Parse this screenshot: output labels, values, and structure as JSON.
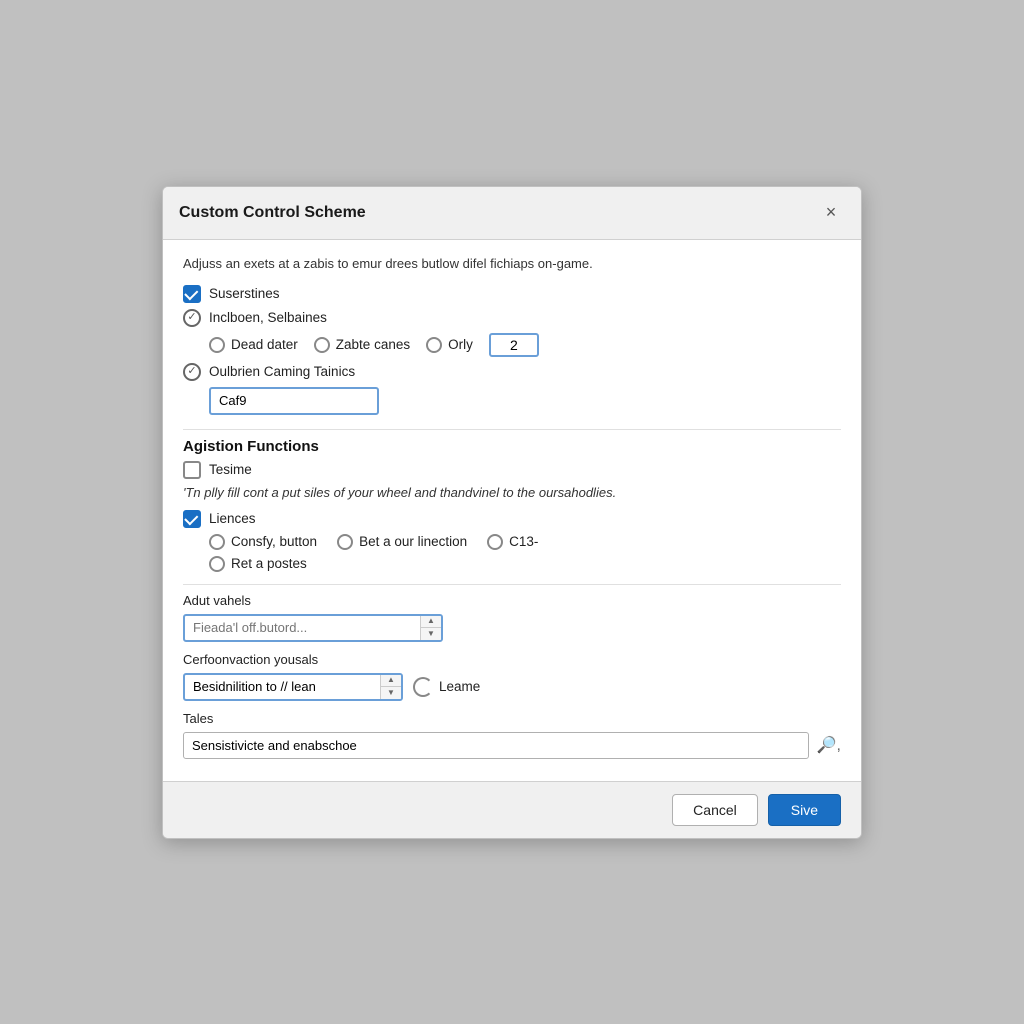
{
  "dialog": {
    "title": "Custom Control Scheme",
    "close_label": "×"
  },
  "description": "Adjuss an exets at a zabis to emur drees butlow difel fichiaps on-game.",
  "sections": {
    "suserstines": {
      "label": "Suserstines",
      "checked": true
    },
    "inclboen": {
      "label": "Inclboen, Selbaines",
      "checked": true,
      "radios": [
        {
          "id": "dead-dater",
          "label": "Dead dater"
        },
        {
          "id": "zabte-canes",
          "label": "Zabte canes"
        },
        {
          "id": "orly",
          "label": "Orly"
        }
      ],
      "number_value": "2"
    },
    "oulbrien": {
      "label": "Oulbrien Caming Tainics",
      "checked": true,
      "spinner_value": "Caf9"
    },
    "agistion": {
      "heading": "Agistion Functions",
      "tesime": {
        "label": "Tesime",
        "checked": false
      },
      "italic_text": "'Tn plly fill cont a put siles of your wheel and thandvinel to the oursahodlies.",
      "liences": {
        "label": "Liences",
        "checked": true,
        "radios": [
          {
            "id": "consfy",
            "label": "Consfy, button"
          },
          {
            "id": "bet-a-our",
            "label": "Bet a our linection"
          },
          {
            "id": "c13",
            "label": "C13-"
          },
          {
            "id": "ret-a-postes",
            "label": "Ret a postes"
          }
        ]
      }
    },
    "adut_vahels": {
      "label": "Adut vahels",
      "placeholder": "Fieada'l off.butord..."
    },
    "cerfoonvaction": {
      "label": "Cerfoonvaction yousals",
      "spinner_value": "Besidnilition to // lean",
      "refresh_label": "Leame"
    },
    "tales": {
      "label": "Tales",
      "value": "Sensistivicte and enabschoe"
    }
  },
  "footer": {
    "cancel_label": "Cancel",
    "save_label": "Sive"
  }
}
